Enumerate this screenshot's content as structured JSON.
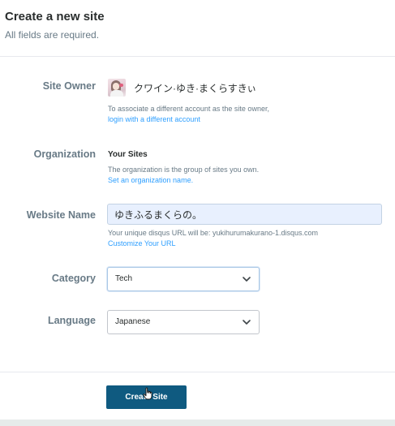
{
  "header": {
    "title": "Create a new site",
    "subtitle": "All fields are required."
  },
  "site_owner": {
    "label": "Site Owner",
    "name": "クワイン·ゆき·まくらすきぃ",
    "help_text": "To associate a different account as the site owner,",
    "help_link": "login with a different account"
  },
  "organization": {
    "label": "Organization",
    "value": "Your Sites",
    "help_text": "The organization is the group of sites you own.",
    "help_link": "Set an organization name."
  },
  "website_name": {
    "label": "Website Name",
    "value": "ゆきふるまくらの。",
    "help_prefix": "Your unique disqus URL will be:",
    "help_url": "yukihurumakurano-1.disqus.com",
    "help_link": "Customize Your URL"
  },
  "category": {
    "label": "Category",
    "selected": "Tech"
  },
  "language": {
    "label": "Language",
    "selected": "Japanese"
  },
  "submit": {
    "label": "Create Site"
  },
  "colors": {
    "link": "#2e9fff",
    "button": "#0f5a80",
    "label": "#687a86",
    "input_autofill": "#e8f0fe"
  },
  "icons": {
    "select_chevron": "chevron-down-icon",
    "pointer": "hand-cursor-icon"
  }
}
